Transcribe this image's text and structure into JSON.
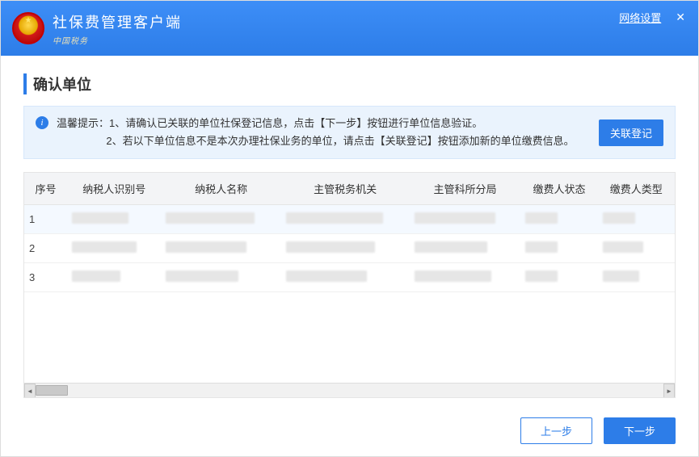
{
  "header": {
    "app_title": "社保费管理客户端",
    "sub_brand": "中国税务",
    "network_link": "网络设置"
  },
  "section": {
    "title": "确认单位"
  },
  "hint": {
    "label": "温馨提示：",
    "line1": "1、请确认已关联的单位社保登记信息，点击【下一步】按钮进行单位信息验证。",
    "line2": "2、若以下单位信息不是本次办理社保业务的单位，请点击【关联登记】按钮添加新的单位缴费信息。",
    "link_btn": "关联登记"
  },
  "table": {
    "columns": [
      "序号",
      "纳税人识别号",
      "纳税人名称",
      "主管税务机关",
      "主管科所分局",
      "缴费人状态",
      "缴费人类型"
    ],
    "rows": [
      {
        "seq": "1"
      },
      {
        "seq": "2"
      },
      {
        "seq": "3"
      }
    ]
  },
  "footer": {
    "prev": "上一步",
    "next": "下一步"
  }
}
